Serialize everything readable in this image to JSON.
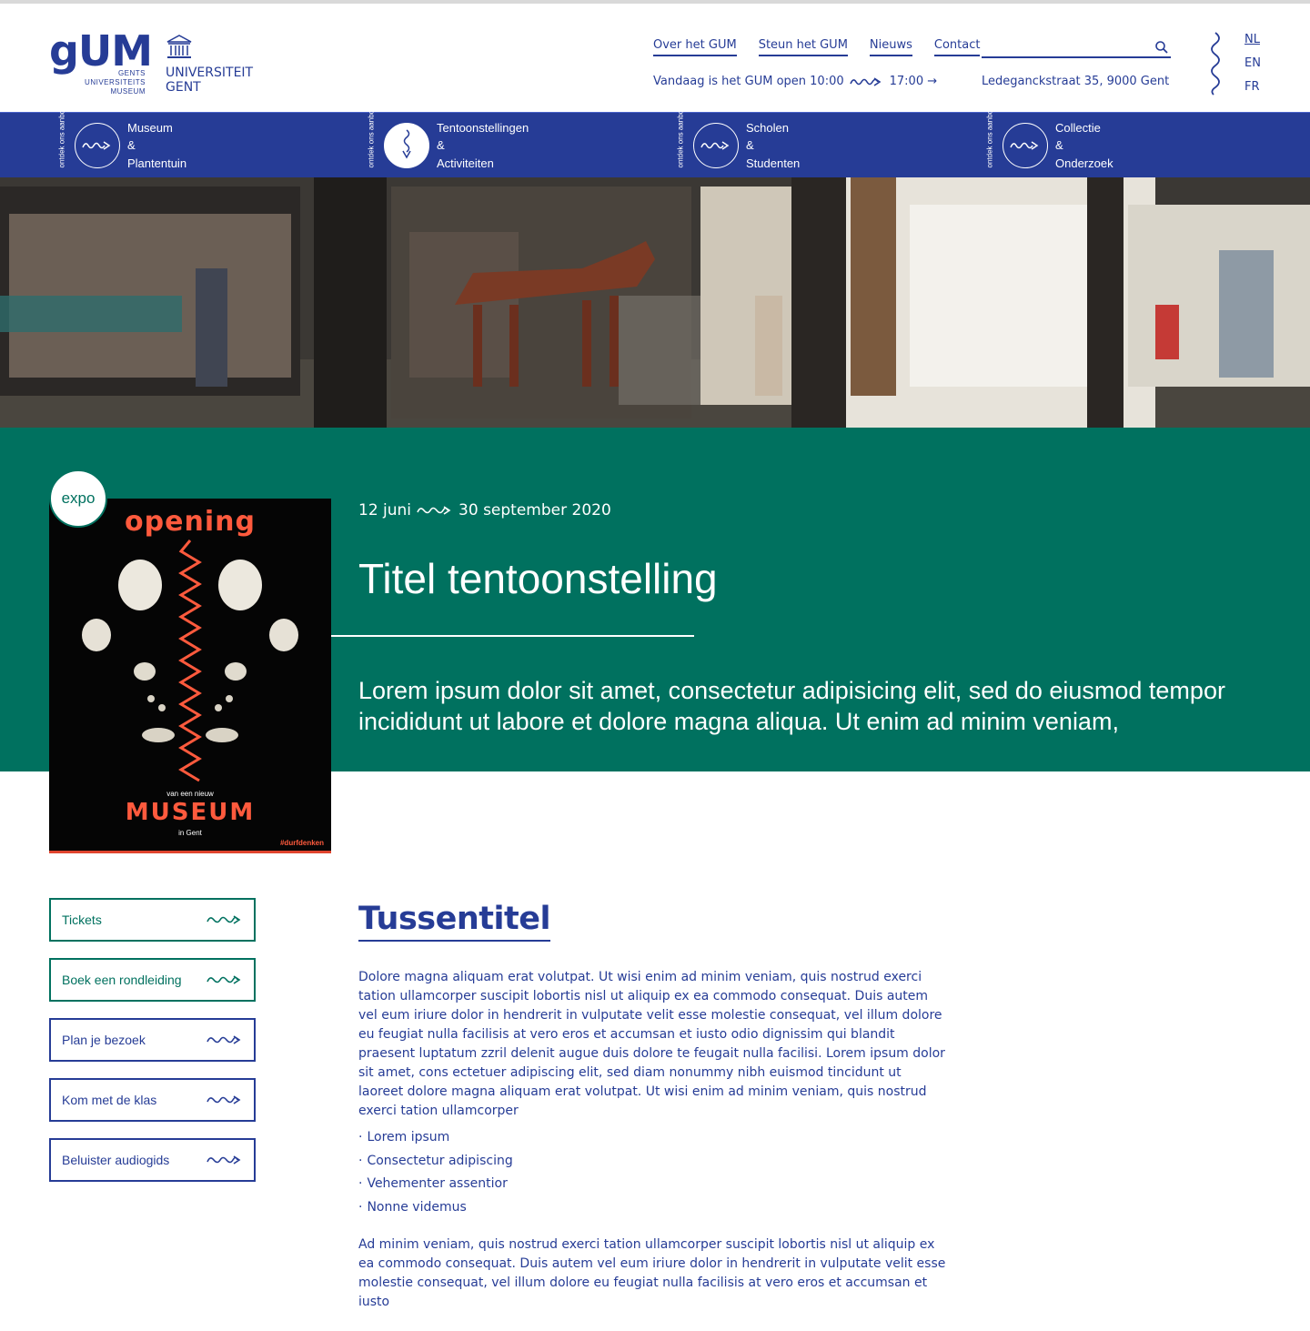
{
  "header": {
    "logo_word": "gUM",
    "logo_sub": [
      "GENTS",
      "UNIVERSITEITS",
      "MUSEUM"
    ],
    "ug_lines": [
      "UNIVERSITEIT",
      "GENT"
    ],
    "nav": [
      "Over het GUM",
      "Steun het GUM",
      "Nieuws",
      "Contact"
    ],
    "search_placeholder": "",
    "open_prefix": "Vandaag is het GUM open 10:00",
    "open_suffix": "17:00 →",
    "address": "Ledeganckstraat 35, 9000 Gent",
    "languages": [
      "NL",
      "EN",
      "FR"
    ],
    "active_language": "NL"
  },
  "categories": [
    {
      "vert": "ontdek ons aanbod",
      "lines": [
        "Museum",
        "&",
        "Plantentuin"
      ],
      "icon": "wave-arrow-icon"
    },
    {
      "vert": "ontdek ons aanbod",
      "lines": [
        "Tentoonstellingen",
        "&",
        "Activiteiten"
      ],
      "icon": "wave-down-icon"
    },
    {
      "vert": "ontdek ons aanbod",
      "lines": [
        "Scholen",
        "&",
        "Studenten"
      ],
      "icon": "wave-arrow-icon"
    },
    {
      "vert": "ontdek ons aanbod",
      "lines": [
        "Collectie",
        "&",
        "Onderzoek"
      ],
      "icon": "wave-arrow-icon"
    }
  ],
  "expo": {
    "badge": "expo",
    "date_start": "12 juni",
    "date_end": "30 september 2020",
    "title": "Titel tentoonstelling",
    "lead": "Lorem ipsum dolor sit amet, consectetur adipisicing elit, sed do eiusmod tempor incididunt ut labore et dolore magna aliqua.  Ut enim ad minim veniam,",
    "poster": {
      "top": "opening",
      "sub": "van een nieuw",
      "main": "MUSEUM",
      "city": "in Gent",
      "tag": "#durfdenken"
    }
  },
  "side_buttons": [
    {
      "label": "Tickets",
      "style": "green"
    },
    {
      "label": "Boek een rondleiding",
      "style": "green"
    },
    {
      "label": "Plan je bezoek",
      "style": "blue"
    },
    {
      "label": "Kom met de klas",
      "style": "blue"
    },
    {
      "label": "Beluister audiogids",
      "style": "blue"
    }
  ],
  "content": {
    "subtitle": "Tussentitel",
    "para1": "Dolore magna aliquam erat volutpat. Ut wisi enim ad minim veniam, quis nostrud exerci tation ullamcorper suscipit lobortis nisl ut aliquip ex ea commodo consequat. Duis autem vel eum iriure dolor in hendrerit in vulputate velit esse molestie consequat, vel illum dolore eu feugiat nulla facilisis at vero eros et accumsan et iusto odio dignissim qui blandit praesent luptatum zzril delenit augue duis dolore te feugait nulla facilisi. Lorem ipsum dolor sit amet, cons ectetuer adipiscing elit, sed diam nonummy nibh euismod tincidunt ut laoreet dolore magna aliquam erat volutpat. Ut wisi enim ad minim veniam, quis nostrud exerci tation ullamcorper",
    "bullets": [
      "Lorem ipsum",
      "Consectetur adipiscing",
      "Vehementer assentior",
      "Nonne videmus"
    ],
    "para2": "Ad minim veniam, quis nostrud exerci tation ullamcorper suscipit lobortis nisl ut aliquip ex ea commodo consequat. Duis autem vel eum iriure dolor in hendrerit in vulputate velit esse molestie consequat, vel illum dolore eu feugiat nulla facilisis at vero eros et accumsan et iusto"
  },
  "colors": {
    "brand_blue": "#263c96",
    "brand_green": "#00715f",
    "poster_red": "#ff5a3d"
  }
}
